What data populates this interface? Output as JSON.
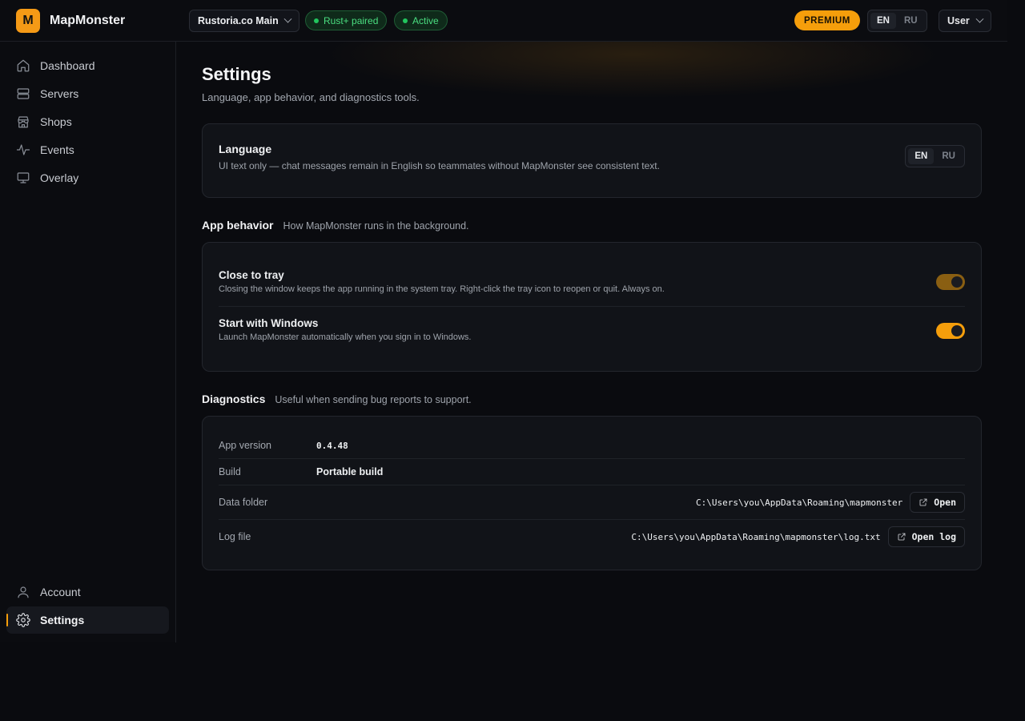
{
  "app": {
    "logo_letter": "M",
    "name": "MapMonster"
  },
  "topbar": {
    "server": "Rustoria.co Main",
    "status_pills": [
      "Rust+ paired",
      "Active"
    ],
    "premium": "PREMIUM",
    "languages": [
      "EN",
      "RU"
    ],
    "active_language": "EN",
    "user": "User"
  },
  "sidebar": {
    "items": [
      {
        "label": "Dashboard",
        "icon": "home-icon"
      },
      {
        "label": "Servers",
        "icon": "server-icon"
      },
      {
        "label": "Shops",
        "icon": "store-icon"
      },
      {
        "label": "Events",
        "icon": "activity-icon"
      },
      {
        "label": "Overlay",
        "icon": "monitor-icon"
      }
    ],
    "bottom_items": [
      {
        "label": "Account",
        "icon": "user-icon"
      },
      {
        "label": "Settings",
        "icon": "gear-icon",
        "active": true
      }
    ]
  },
  "page": {
    "title": "Settings",
    "subtitle": "Language, app behavior, and diagnostics tools."
  },
  "language_card": {
    "title": "Language",
    "description": "UI text only — chat messages remain in English so teammates without MapMonster see consistent text.",
    "options": [
      "EN",
      "RU"
    ],
    "active": "EN"
  },
  "app_behavior": {
    "title": "App behavior",
    "description": "How MapMonster runs in the background.",
    "settings": [
      {
        "title": "Close to tray",
        "description": "Closing the window keeps the app running in the system tray. Right-click the tray icon to reopen or quit. Always on.",
        "enabled": true,
        "locked": true
      },
      {
        "title": "Start with Windows",
        "description": "Launch MapMonster automatically when you sign in to Windows.",
        "enabled": true,
        "locked": false
      }
    ]
  },
  "diagnostics": {
    "title": "Diagnostics",
    "description": "Useful when sending bug reports to support.",
    "rows": [
      {
        "label": "App version",
        "value": "0.4.48"
      },
      {
        "label": "Build",
        "value": "Portable build"
      },
      {
        "label": "Data folder",
        "value": "C:\\Users\\you\\AppData\\Roaming\\mapmonster",
        "button": "Open"
      },
      {
        "label": "Log file",
        "value": "C:\\Users\\you\\AppData\\Roaming\\mapmonster\\log.txt",
        "button": "Open log"
      }
    ]
  },
  "colors": {
    "accent": "#f59e0b",
    "success": "#22c55e",
    "background": "#0a0b0f",
    "card": "#111318"
  }
}
